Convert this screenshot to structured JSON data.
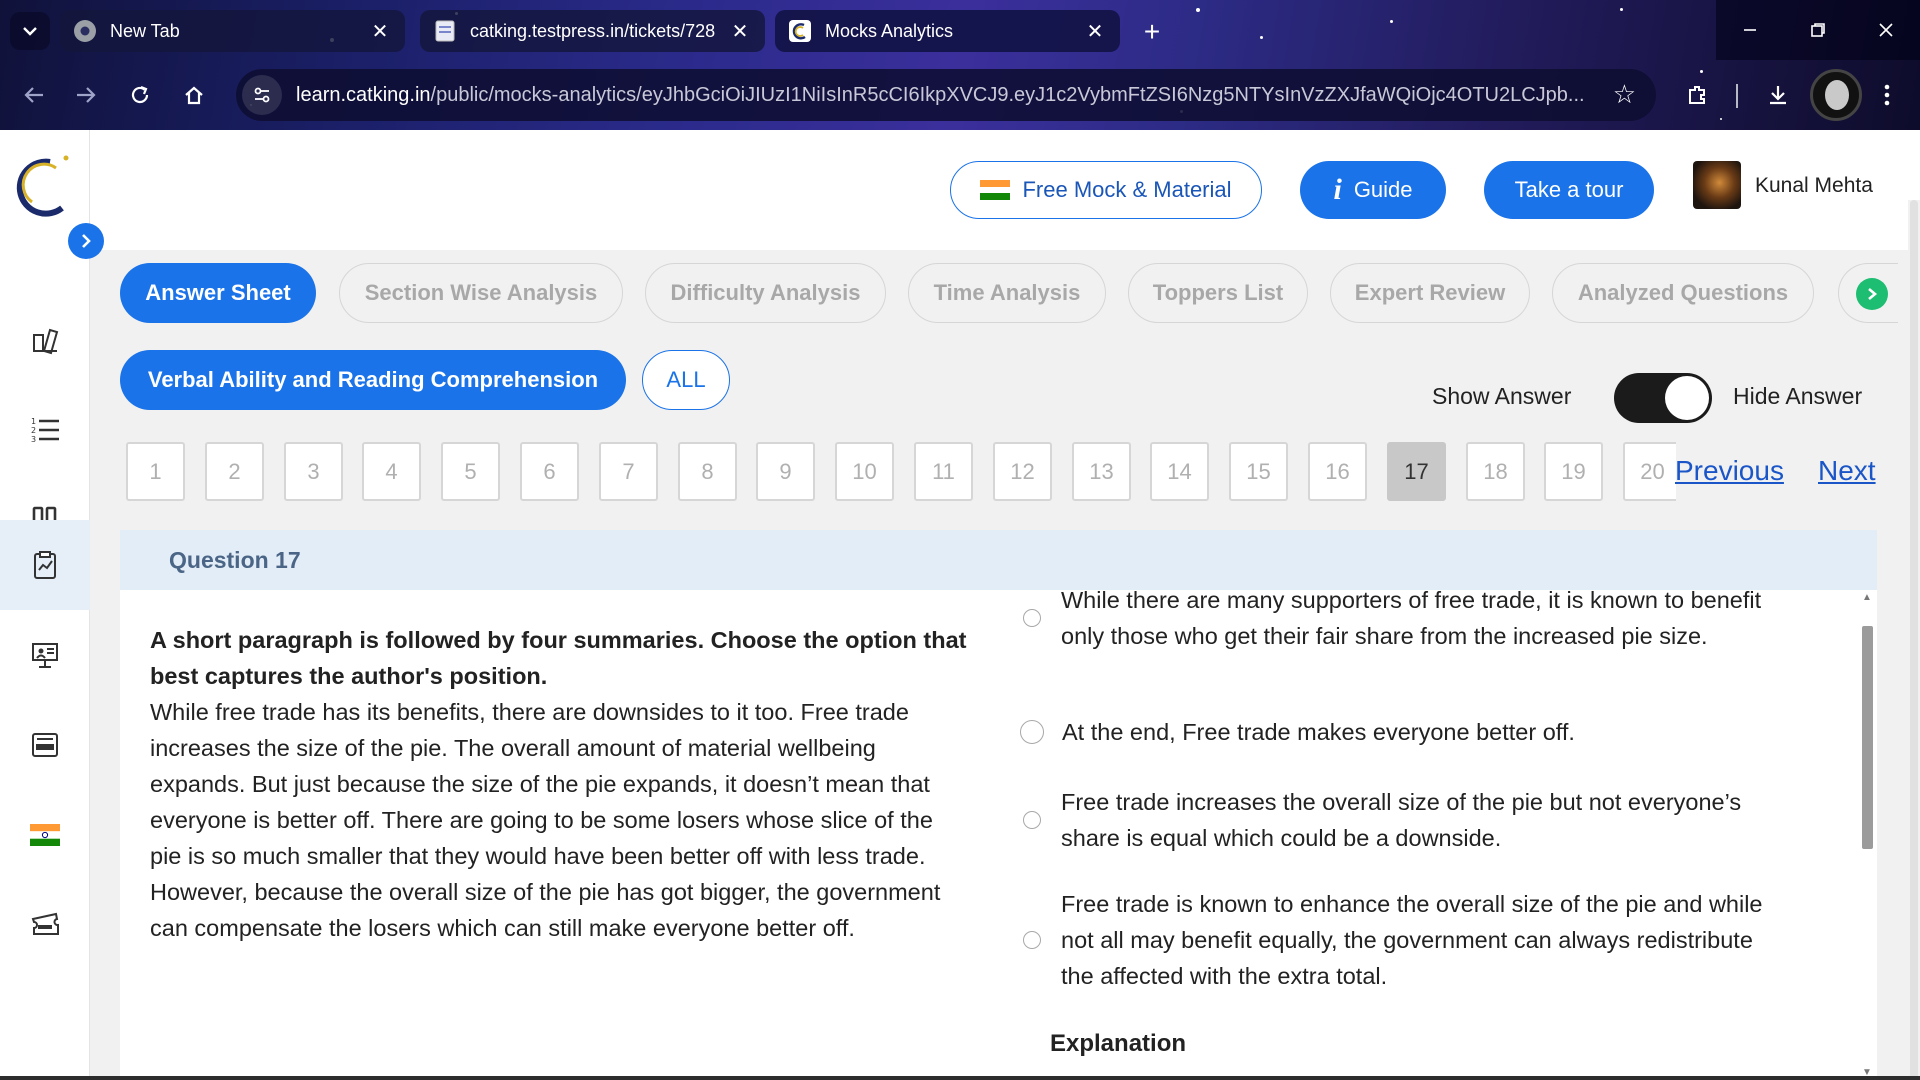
{
  "browser": {
    "tabs": [
      {
        "title": "New Tab",
        "favicon": "chrome-icon",
        "close": "✕"
      },
      {
        "title": "catking.testpress.in/tickets/728",
        "favicon": "page-icon",
        "close": "✕"
      },
      {
        "title": "Mocks Analytics",
        "favicon": "catking-icon",
        "close": "✕"
      }
    ],
    "new_tab_glyph": "+",
    "url_host": "learn.catking.in",
    "url_path": "/public/mocks-analytics/eyJhbGciOiJIUzI1NiIsInR5cCI6IkpXVCJ9.eyJ1c2VybmFtZSI6Nzg5NTYsInVzZXJfaWQiOjc4OTU2LCJpb..."
  },
  "header": {
    "free_mock_label": "Free Mock & Material",
    "guide_label": "Guide",
    "tour_label": "Take a tour",
    "user_name": "Kunal Mehta"
  },
  "analysis_tabs": [
    {
      "label": "Answer Sheet",
      "active": true
    },
    {
      "label": "Section Wise Analysis"
    },
    {
      "label": "Difficulty Analysis"
    },
    {
      "label": "Time Analysis"
    },
    {
      "label": "Toppers List"
    },
    {
      "label": "Expert Review"
    },
    {
      "label": "Analyzed Questions"
    }
  ],
  "sections": {
    "active": "Verbal Ability and Reading Comprehension",
    "all": "ALL"
  },
  "answer_toggle": {
    "show_label": "Show Answer",
    "hide_label": "Hide Answer",
    "state": "hide"
  },
  "question_numbers": [
    "1",
    "2",
    "3",
    "4",
    "5",
    "6",
    "7",
    "8",
    "9",
    "10",
    "11",
    "12",
    "13",
    "14",
    "15",
    "16",
    "17",
    "18",
    "19",
    "20"
  ],
  "current_question": "17",
  "pager": {
    "previous": "Previous",
    "next": "Next"
  },
  "question": {
    "header": "Question 17",
    "lead": "A short paragraph is followed by four summaries. Choose the option that best captures the author's position.",
    "passage": "While free trade has its benefits, there are downsides to it too. Free trade increases the size of the pie. The overall amount of material wellbeing expands. But just because the size of the pie expands, it doesn’t mean that everyone is better off. There are going to be some losers whose slice of the pie is so much smaller that they would have been better off with less trade. However, because the overall size of the pie has got bigger, the government can compensate the losers which can still make everyone better off.",
    "options": [
      "While there are many supporters of free trade, it is known to benefit only those who get their fair share from the increased pie size.",
      "At the end, Free trade makes everyone better off.",
      "Free trade increases the overall size of the pie but not everyone’s share is equal which could be a downside.",
      "Free trade is known to enhance the overall size of the pie and while not all may benefit equally, the government can always redistribute the affected with the extra total."
    ],
    "explanation_label": "Explanation"
  },
  "colors": {
    "primary": "#1a73e8",
    "header_band": "#e3edf8",
    "success_arrow": "#1dbd72"
  }
}
